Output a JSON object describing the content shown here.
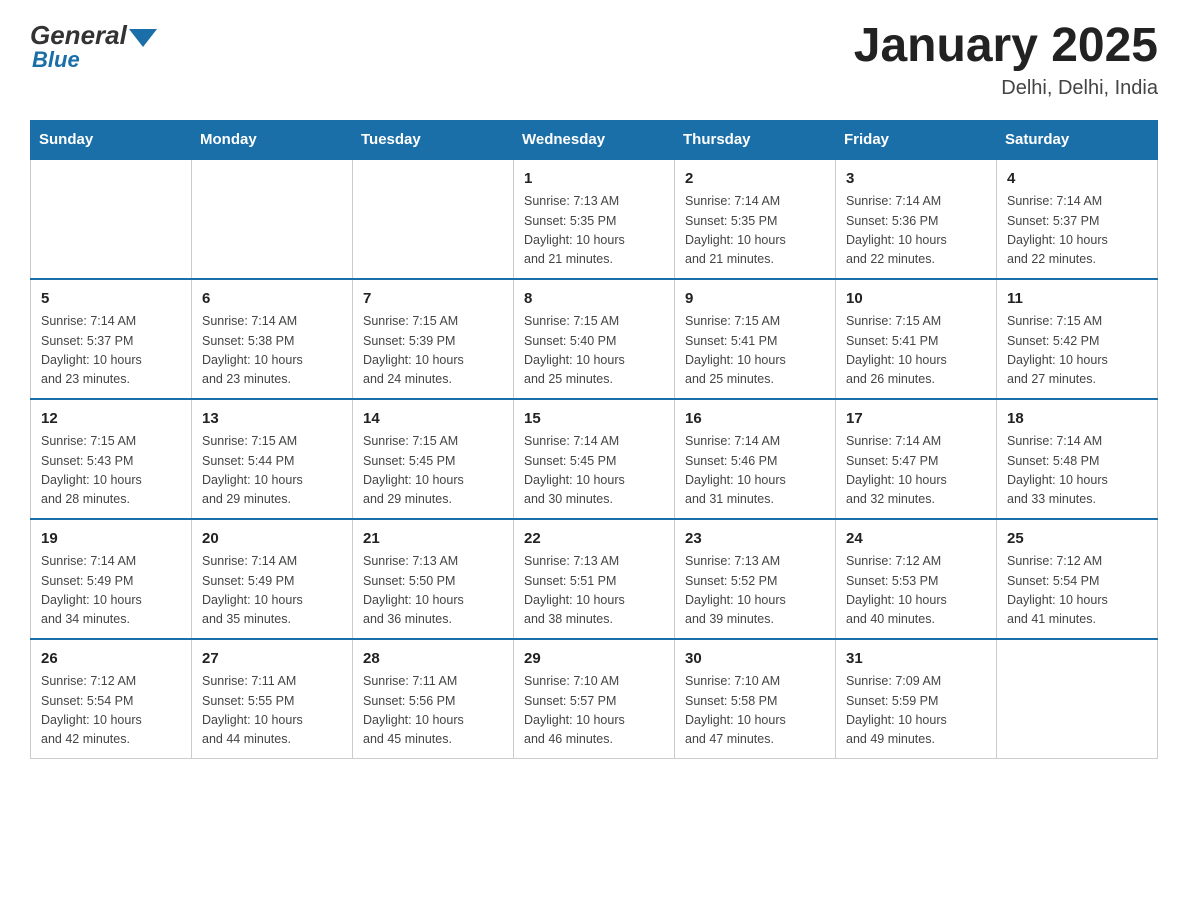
{
  "header": {
    "logo_general": "General",
    "logo_blue": "Blue",
    "main_title": "January 2025",
    "subtitle": "Delhi, Delhi, India"
  },
  "calendar": {
    "days_of_week": [
      "Sunday",
      "Monday",
      "Tuesday",
      "Wednesday",
      "Thursday",
      "Friday",
      "Saturday"
    ],
    "weeks": [
      [
        {
          "day": "",
          "info": ""
        },
        {
          "day": "",
          "info": ""
        },
        {
          "day": "",
          "info": ""
        },
        {
          "day": "1",
          "info": "Sunrise: 7:13 AM\nSunset: 5:35 PM\nDaylight: 10 hours\nand 21 minutes."
        },
        {
          "day": "2",
          "info": "Sunrise: 7:14 AM\nSunset: 5:35 PM\nDaylight: 10 hours\nand 21 minutes."
        },
        {
          "day": "3",
          "info": "Sunrise: 7:14 AM\nSunset: 5:36 PM\nDaylight: 10 hours\nand 22 minutes."
        },
        {
          "day": "4",
          "info": "Sunrise: 7:14 AM\nSunset: 5:37 PM\nDaylight: 10 hours\nand 22 minutes."
        }
      ],
      [
        {
          "day": "5",
          "info": "Sunrise: 7:14 AM\nSunset: 5:37 PM\nDaylight: 10 hours\nand 23 minutes."
        },
        {
          "day": "6",
          "info": "Sunrise: 7:14 AM\nSunset: 5:38 PM\nDaylight: 10 hours\nand 23 minutes."
        },
        {
          "day": "7",
          "info": "Sunrise: 7:15 AM\nSunset: 5:39 PM\nDaylight: 10 hours\nand 24 minutes."
        },
        {
          "day": "8",
          "info": "Sunrise: 7:15 AM\nSunset: 5:40 PM\nDaylight: 10 hours\nand 25 minutes."
        },
        {
          "day": "9",
          "info": "Sunrise: 7:15 AM\nSunset: 5:41 PM\nDaylight: 10 hours\nand 25 minutes."
        },
        {
          "day": "10",
          "info": "Sunrise: 7:15 AM\nSunset: 5:41 PM\nDaylight: 10 hours\nand 26 minutes."
        },
        {
          "day": "11",
          "info": "Sunrise: 7:15 AM\nSunset: 5:42 PM\nDaylight: 10 hours\nand 27 minutes."
        }
      ],
      [
        {
          "day": "12",
          "info": "Sunrise: 7:15 AM\nSunset: 5:43 PM\nDaylight: 10 hours\nand 28 minutes."
        },
        {
          "day": "13",
          "info": "Sunrise: 7:15 AM\nSunset: 5:44 PM\nDaylight: 10 hours\nand 29 minutes."
        },
        {
          "day": "14",
          "info": "Sunrise: 7:15 AM\nSunset: 5:45 PM\nDaylight: 10 hours\nand 29 minutes."
        },
        {
          "day": "15",
          "info": "Sunrise: 7:14 AM\nSunset: 5:45 PM\nDaylight: 10 hours\nand 30 minutes."
        },
        {
          "day": "16",
          "info": "Sunrise: 7:14 AM\nSunset: 5:46 PM\nDaylight: 10 hours\nand 31 minutes."
        },
        {
          "day": "17",
          "info": "Sunrise: 7:14 AM\nSunset: 5:47 PM\nDaylight: 10 hours\nand 32 minutes."
        },
        {
          "day": "18",
          "info": "Sunrise: 7:14 AM\nSunset: 5:48 PM\nDaylight: 10 hours\nand 33 minutes."
        }
      ],
      [
        {
          "day": "19",
          "info": "Sunrise: 7:14 AM\nSunset: 5:49 PM\nDaylight: 10 hours\nand 34 minutes."
        },
        {
          "day": "20",
          "info": "Sunrise: 7:14 AM\nSunset: 5:49 PM\nDaylight: 10 hours\nand 35 minutes."
        },
        {
          "day": "21",
          "info": "Sunrise: 7:13 AM\nSunset: 5:50 PM\nDaylight: 10 hours\nand 36 minutes."
        },
        {
          "day": "22",
          "info": "Sunrise: 7:13 AM\nSunset: 5:51 PM\nDaylight: 10 hours\nand 38 minutes."
        },
        {
          "day": "23",
          "info": "Sunrise: 7:13 AM\nSunset: 5:52 PM\nDaylight: 10 hours\nand 39 minutes."
        },
        {
          "day": "24",
          "info": "Sunrise: 7:12 AM\nSunset: 5:53 PM\nDaylight: 10 hours\nand 40 minutes."
        },
        {
          "day": "25",
          "info": "Sunrise: 7:12 AM\nSunset: 5:54 PM\nDaylight: 10 hours\nand 41 minutes."
        }
      ],
      [
        {
          "day": "26",
          "info": "Sunrise: 7:12 AM\nSunset: 5:54 PM\nDaylight: 10 hours\nand 42 minutes."
        },
        {
          "day": "27",
          "info": "Sunrise: 7:11 AM\nSunset: 5:55 PM\nDaylight: 10 hours\nand 44 minutes."
        },
        {
          "day": "28",
          "info": "Sunrise: 7:11 AM\nSunset: 5:56 PM\nDaylight: 10 hours\nand 45 minutes."
        },
        {
          "day": "29",
          "info": "Sunrise: 7:10 AM\nSunset: 5:57 PM\nDaylight: 10 hours\nand 46 minutes."
        },
        {
          "day": "30",
          "info": "Sunrise: 7:10 AM\nSunset: 5:58 PM\nDaylight: 10 hours\nand 47 minutes."
        },
        {
          "day": "31",
          "info": "Sunrise: 7:09 AM\nSunset: 5:59 PM\nDaylight: 10 hours\nand 49 minutes."
        },
        {
          "day": "",
          "info": ""
        }
      ]
    ]
  }
}
